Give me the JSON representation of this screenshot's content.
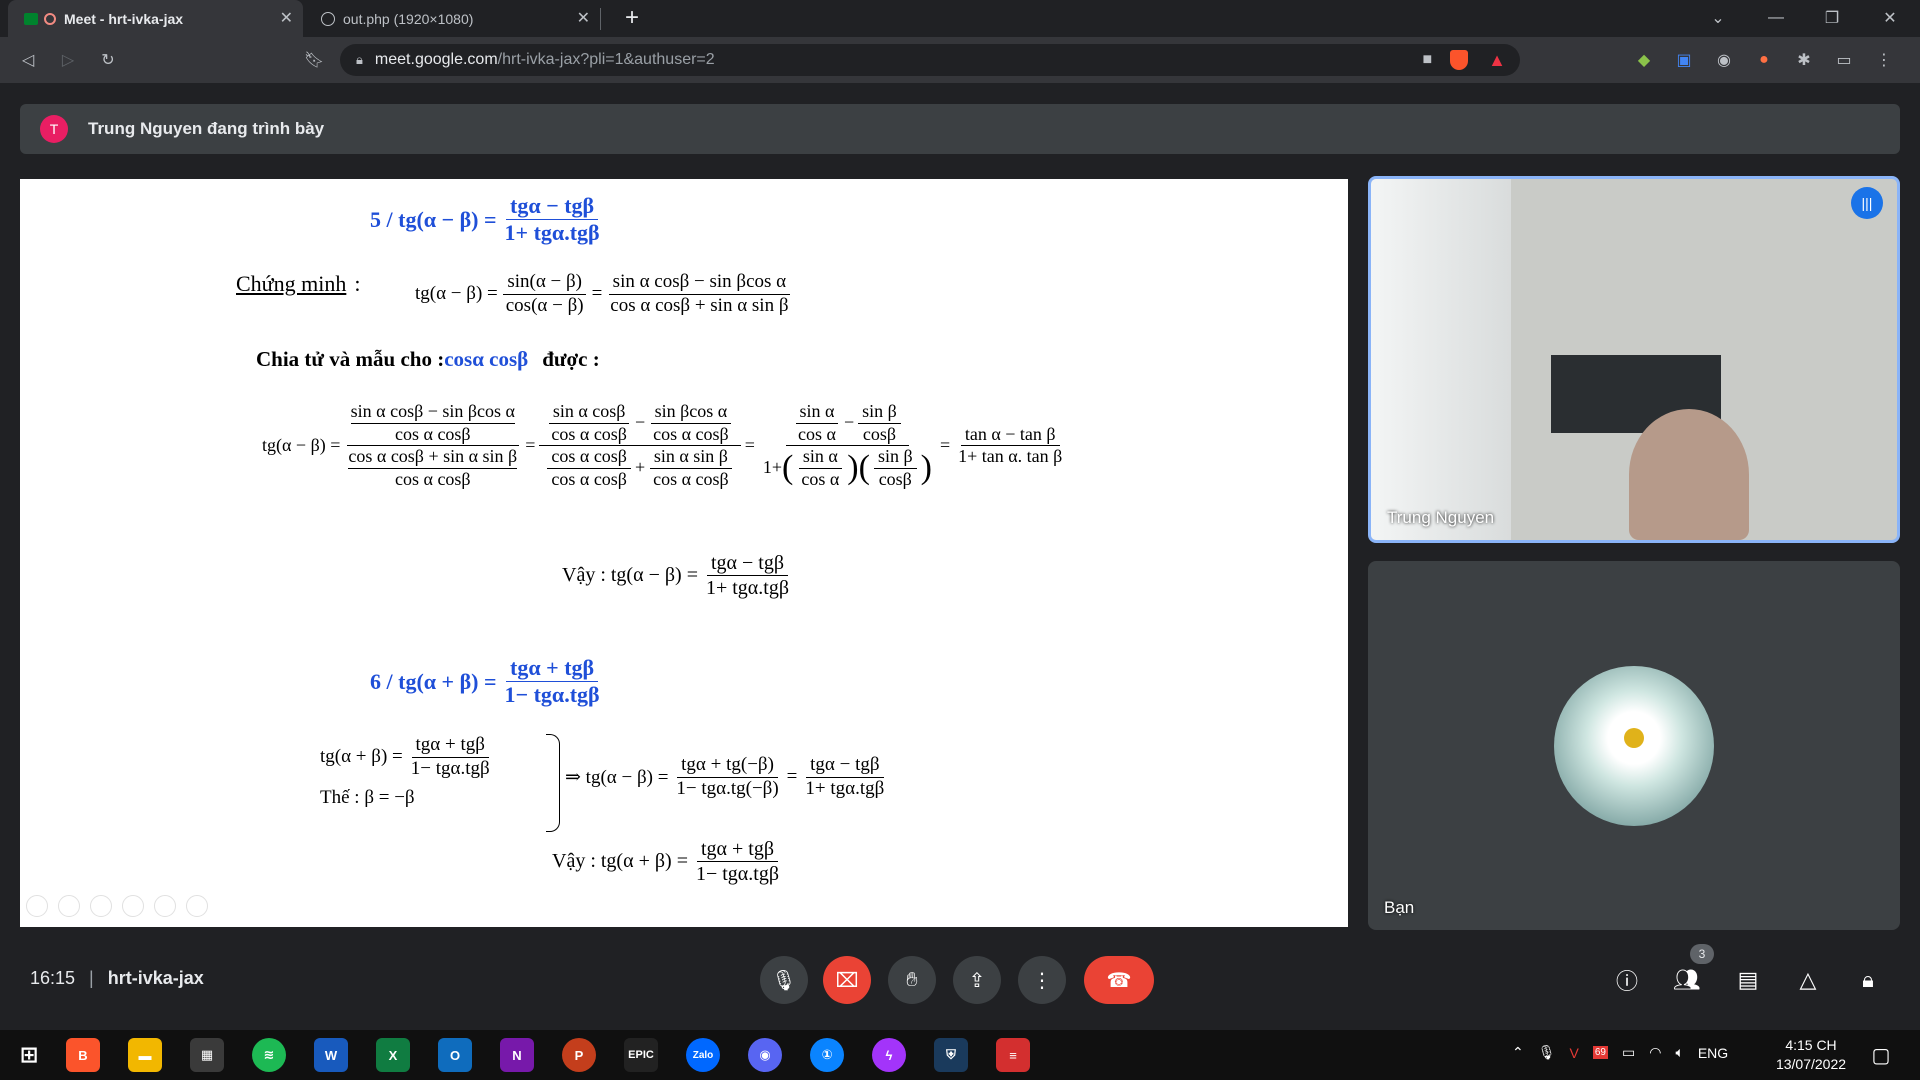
{
  "browser": {
    "tabs": [
      {
        "title": "Meet - hrt-ivka-jax",
        "active": true
      },
      {
        "title": "out.php (1920×1080)",
        "active": false
      }
    ],
    "url_domain": "meet.google.com",
    "url_path": "/hrt-ivka-jax?pli=1&authuser=2"
  },
  "presenting": {
    "initial": "T",
    "text": "Trung Nguyen đang trình bày"
  },
  "slide": {
    "f5_left": "5 / tg(α − β) =",
    "f5_num": "tgα − tgβ",
    "f5_den": "1+ tgα.tgβ",
    "proof_label": "Chứng minh",
    "proof_colon": ":",
    "proof_lhs": "tg(α − β) =",
    "proof_f1_num": "sin(α − β)",
    "proof_f1_den": "cos(α − β)",
    "eq": "=",
    "proof_f2_num": "sin α cosβ − sin βcos α",
    "proof_f2_den": "cos α cosβ + sin α sin β",
    "chia_pre": "Chia tử và mẫu cho :",
    "chia_blue": "cosα cosβ",
    "chia_post": "được :",
    "big_lhs": "tg(α − β) =",
    "big_a1": "sin α cosβ − sin βcos α",
    "big_a2": "cos α cosβ",
    "big_a3": "cos α cosβ + sin α sin β",
    "big_a4": "cos α cosβ",
    "big_b1": "sin α cosβ",
    "big_b2": "cos α cosβ",
    "big_b3": "sin βcos α",
    "big_b4": "cos α cosβ",
    "big_b5": "cos α cosβ",
    "big_b6": "cos α cosβ",
    "big_b7": "sin α sin β",
    "big_b8": "cos α cosβ",
    "big_c1": "sin α",
    "big_c2": "cos α",
    "big_c3": "sin β",
    "big_c4": "cosβ",
    "big_c5": "1+",
    "big_d_num": "tan α − tan β",
    "big_d_den": "1+ tan α. tan β",
    "minus": "−",
    "plus": "+",
    "vay1_lhs": "Vậy : tg(α − β) =",
    "vay1_num": "tgα − tgβ",
    "vay1_den": "1+ tgα.tgβ",
    "f6_left": "6 / tg(α + β) =",
    "f6_num": "tgα + tgβ",
    "f6_den": "1− tgα.tgβ",
    "sys_lhs": "tg(α + β) =",
    "sys_num": "tgα + tgβ",
    "sys_den": "1− tgα.tgβ",
    "sys_sub": "Thế : β = −β",
    "sys_imp": "⇒ tg(α − β) =",
    "sys_r1_num": "tgα + tg(−β)",
    "sys_r1_den": "1− tgα.tg(−β)",
    "sys_r2_num": "tgα − tgβ",
    "sys_r2_den": "1+ tgα.tgβ",
    "vay2_lhs": "Vậy : tg(α + β) =",
    "vay2_num": "tgα + tgβ",
    "vay2_den": "1− tgα.tgβ"
  },
  "participants": [
    {
      "name": "Trung Nguyen"
    },
    {
      "name": "Bạn"
    }
  ],
  "meeting": {
    "time": "16:15",
    "code": "hrt-ivka-jax",
    "people_badge": "3"
  },
  "taskbar": {
    "apps": [
      "Zalo"
    ],
    "lang": "ENG",
    "clock_time": "4:15 CH",
    "clock_date": "13/07/2022",
    "epic_text": "EPIC",
    "badge_69": "69"
  },
  "colors": {
    "accent": "#8ab4f8",
    "end_call": "#ea4335",
    "slide_blue": "#1f4fd8"
  }
}
